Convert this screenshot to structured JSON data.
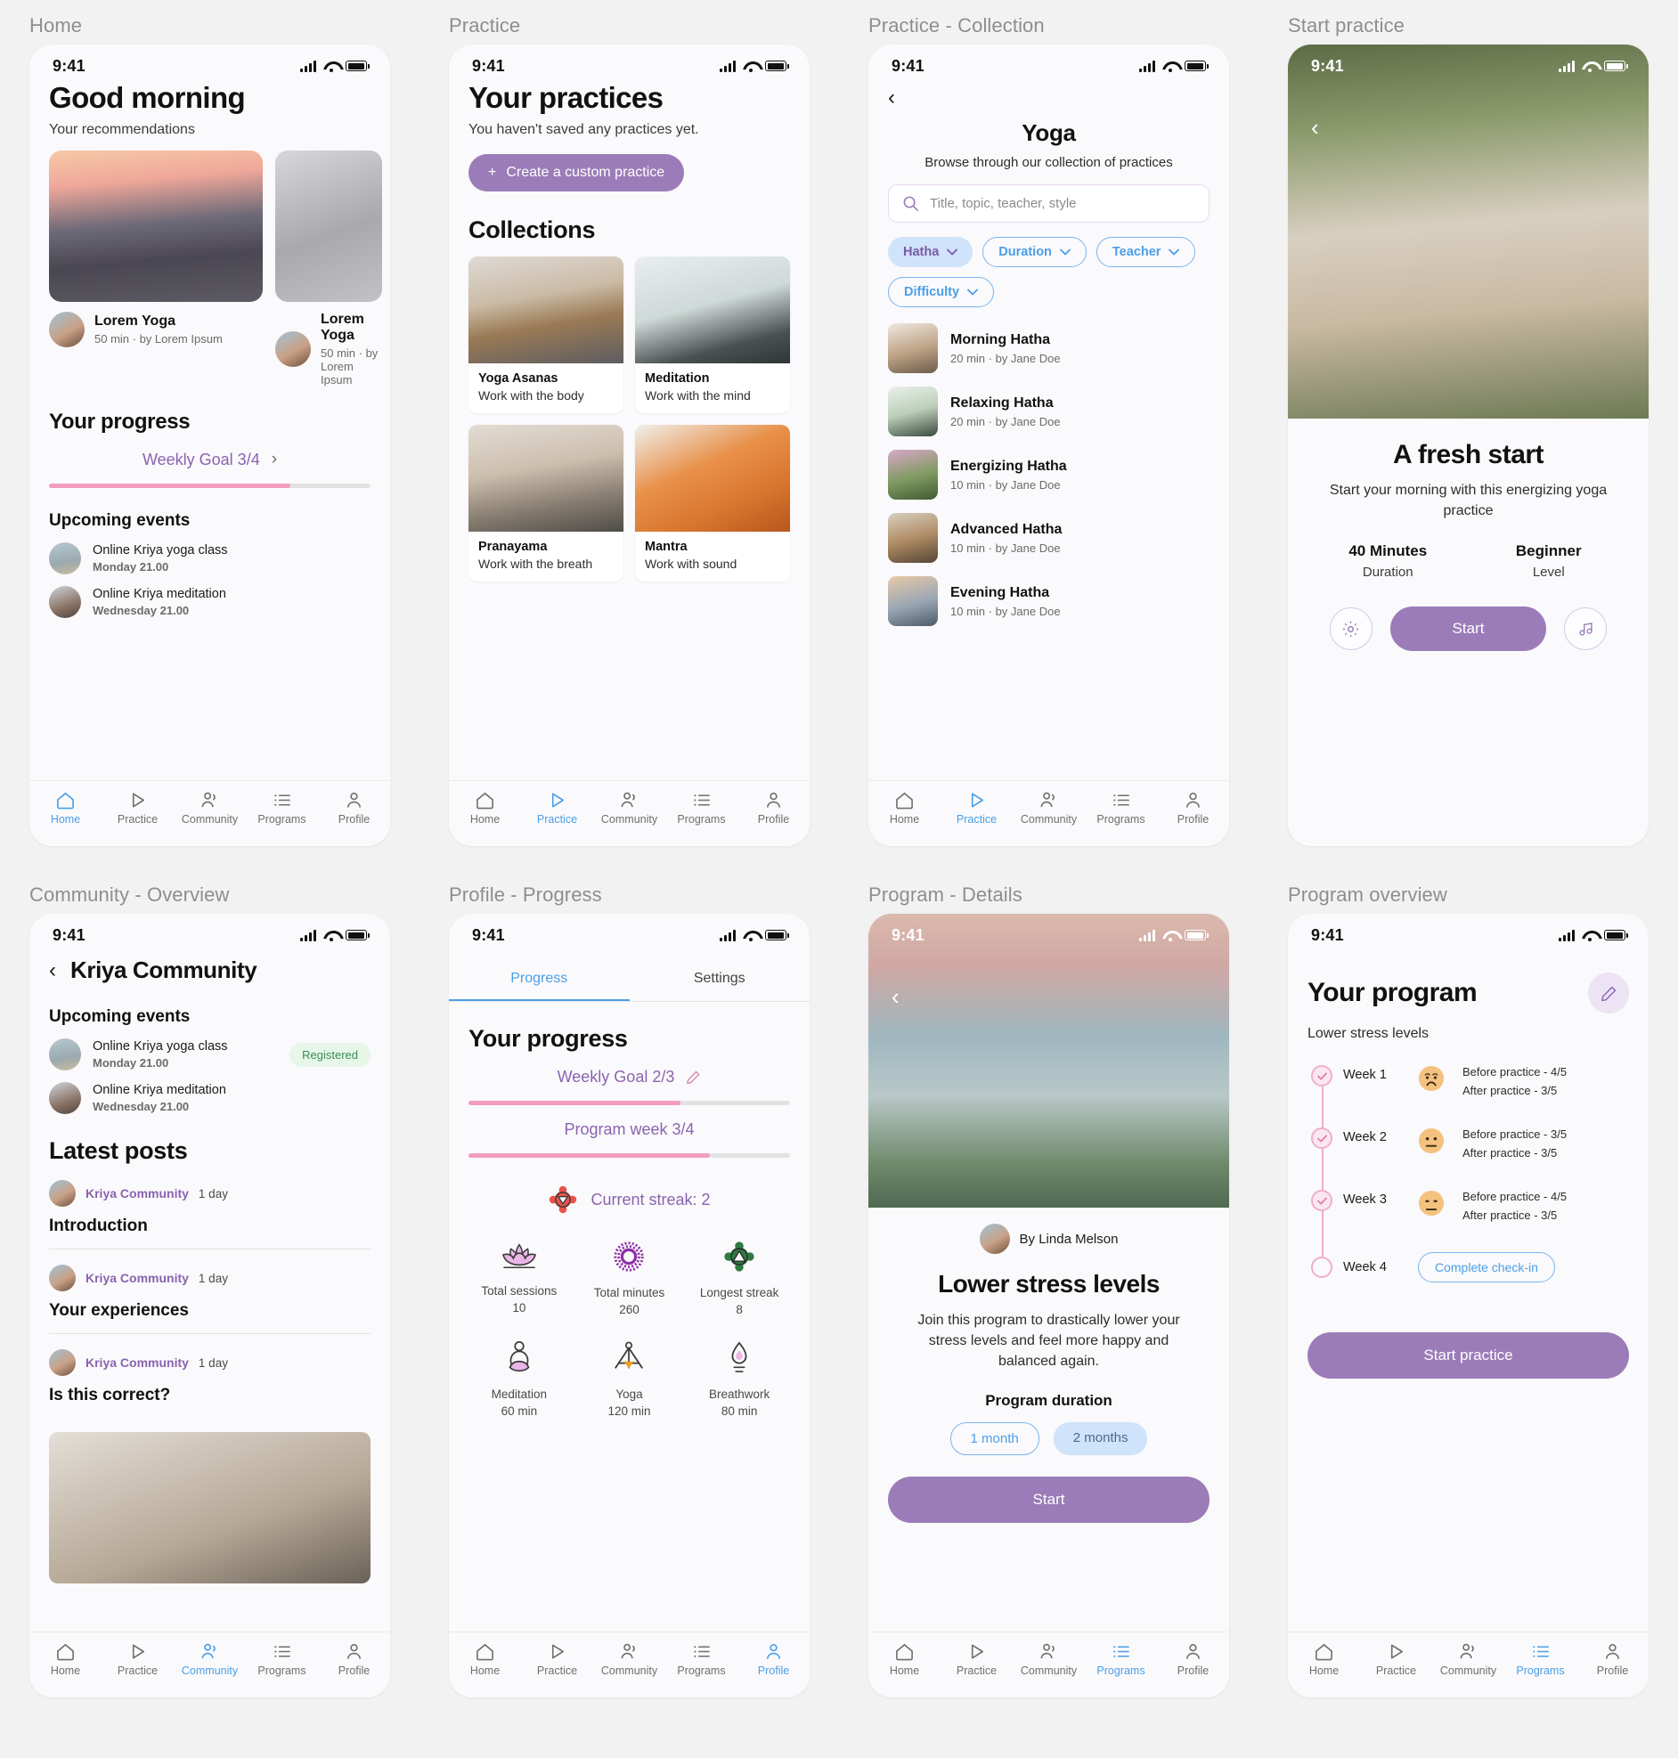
{
  "labels": {
    "home": "Home",
    "practice": "Practice",
    "practice_collection": "Practice - Collection",
    "start_practice": "Start practice",
    "community_overview": "Community - Overview",
    "profile_progress": "Profile - Progress",
    "program_details": "Program - Details",
    "program_overview": "Program overview"
  },
  "status": {
    "time": "9:41"
  },
  "nav": {
    "home": "Home",
    "practice": "Practice",
    "community": "Community",
    "programs": "Programs",
    "profile": "Profile"
  },
  "home": {
    "greeting": "Good morning",
    "subtitle": "Your recommendations",
    "recommendations": [
      {
        "title": "Lorem Yoga",
        "meta": "50 min · by Lorem Ipsum"
      },
      {
        "title": "Lorem Yoga",
        "meta": "50 min · by Lorem Ipsum"
      }
    ],
    "progress_title": "Your progress",
    "weekly_goal": "Weekly Goal 3/4",
    "weekly_goal_percent": 75,
    "events_title": "Upcoming events",
    "events": [
      {
        "title": "Online Kriya yoga class",
        "when": "Monday 21.00"
      },
      {
        "title": "Online Kriya meditation",
        "when": "Wednesday 21.00"
      }
    ]
  },
  "practice": {
    "title": "Your practices",
    "empty_text": "You haven't saved any practices yet.",
    "create_button": "Create a custom practice",
    "collections_title": "Collections",
    "collections": [
      {
        "title": "Yoga Asanas",
        "subtitle": "Work with the body"
      },
      {
        "title": "Meditation",
        "subtitle": "Work with the mind"
      },
      {
        "title": "Pranayama",
        "subtitle": "Work with the breath"
      },
      {
        "title": "Mantra",
        "subtitle": "Work with sound"
      }
    ]
  },
  "collection": {
    "title": "Yoga",
    "subtitle": "Browse through our collection of practices",
    "search_placeholder": "Title, topic, teacher, style",
    "filters": [
      {
        "label": "Hatha",
        "style": "filled"
      },
      {
        "label": "Duration",
        "style": "outline"
      },
      {
        "label": "Teacher",
        "style": "outline"
      },
      {
        "label": "Difficulty",
        "style": "outline"
      }
    ],
    "practices": [
      {
        "title": "Morning Hatha",
        "meta": "20 min · by Jane Doe"
      },
      {
        "title": "Relaxing Hatha",
        "meta": "20 min · by Jane Doe"
      },
      {
        "title": "Energizing Hatha",
        "meta": "10 min · by Jane Doe"
      },
      {
        "title": "Advanced Hatha",
        "meta": "10 min · by Jane Doe"
      },
      {
        "title": "Evening Hatha",
        "meta": "10 min · by Jane Doe"
      }
    ]
  },
  "start": {
    "title": "A fresh start",
    "description": "Start your morning with this energizing yoga practice",
    "duration_value": "40 Minutes",
    "duration_label": "Duration",
    "level_value": "Beginner",
    "level_label": "Level",
    "start_button": "Start",
    "settings_icon": "gear-icon",
    "music_icon": "music-note-icon"
  },
  "community": {
    "title": "Kriya Community",
    "events_title": "Upcoming events",
    "events": [
      {
        "title": "Online Kriya yoga class",
        "when": "Monday 21.00",
        "badge": "Registered"
      },
      {
        "title": "Online Kriya meditation",
        "when": "Wednesday 21.00",
        "badge": ""
      }
    ],
    "posts_title": "Latest posts",
    "posts": [
      {
        "author": "Kriya Community",
        "ago": "1 day",
        "title": "Introduction"
      },
      {
        "author": "Kriya Community",
        "ago": "1 day",
        "title": "Your experiences"
      },
      {
        "author": "Kriya Community",
        "ago": "1 day",
        "title": "Is this correct?"
      }
    ]
  },
  "profile": {
    "tab_progress": "Progress",
    "tab_settings": "Settings",
    "progress_title": "Your progress",
    "weekly_goal": "Weekly Goal 2/3",
    "weekly_goal_percent": 66,
    "program_week": "Program week 3/4",
    "program_week_percent": 75,
    "streak_label": "Current streak: 2",
    "stats": [
      {
        "name": "Total sessions",
        "value": "10",
        "icon": "lotus-icon"
      },
      {
        "name": "Total minutes",
        "value": "260",
        "icon": "mandala-icon"
      },
      {
        "name": "Longest streak",
        "value": "8",
        "icon": "triangle-chakra-icon"
      },
      {
        "name": "Meditation",
        "value": "60 min",
        "icon": "sitting-meditation-icon"
      },
      {
        "name": "Yoga",
        "value": "120 min",
        "icon": "yoga-pose-icon"
      },
      {
        "name": "Breathwork",
        "value": "80 min",
        "icon": "breath-icon"
      }
    ]
  },
  "program_details": {
    "author_prefix": "By Linda Melson",
    "title": "Lower stress levels",
    "description": "Join this program to drastically lower your stress levels and feel more happy and balanced again.",
    "duration_title": "Program duration",
    "durations": [
      {
        "label": "1 month",
        "selected": false
      },
      {
        "label": "2 months",
        "selected": true
      }
    ],
    "start_button": "Start"
  },
  "program_overview": {
    "title": "Your program",
    "program_name": "Lower stress levels",
    "edit_icon": "pencil-icon",
    "weeks": [
      {
        "label": "Week 1",
        "before": "Before practice - 4/5",
        "after": "After practice - 3/5",
        "emoji": "frowning-face",
        "done": true
      },
      {
        "label": "Week 2",
        "before": "Before practice - 3/5",
        "after": "After practice - 3/5",
        "emoji": "neutral-face",
        "done": true
      },
      {
        "label": "Week 3",
        "before": "Before practice - 4/5",
        "after": "After practice - 3/5",
        "emoji": "slight-frown-face",
        "done": true
      },
      {
        "label": "Week 4",
        "before": "",
        "after": "",
        "emoji": "",
        "done": false
      }
    ],
    "checkin_button": "Complete check-in",
    "start_button": "Start practice"
  }
}
